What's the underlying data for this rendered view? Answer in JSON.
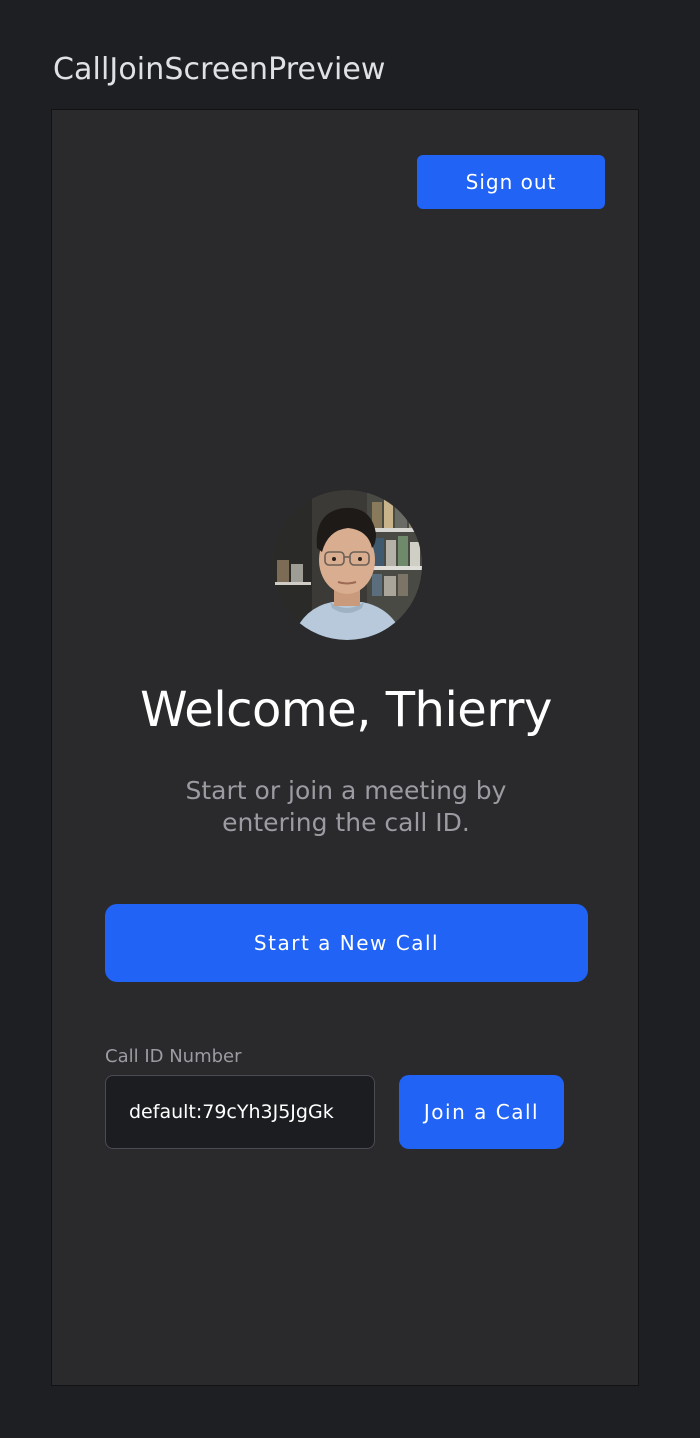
{
  "preview": {
    "title": "CallJoinScreenPreview"
  },
  "header": {
    "sign_out_label": "Sign out"
  },
  "profile": {
    "avatar_icon": "user-avatar-photo",
    "welcome_text": "Welcome, Thierry",
    "subtitle": "Start or join a meeting by entering the call ID."
  },
  "actions": {
    "start_call_label": "Start a New Call",
    "call_id_label": "Call ID Number",
    "call_id_value": "default:79cYh3J5JgGk",
    "join_call_label": "Join a Call"
  },
  "colors": {
    "accent": "#2063f5",
    "screen_background": "#2a2a2d",
    "outer_background": "#1e1f22"
  }
}
